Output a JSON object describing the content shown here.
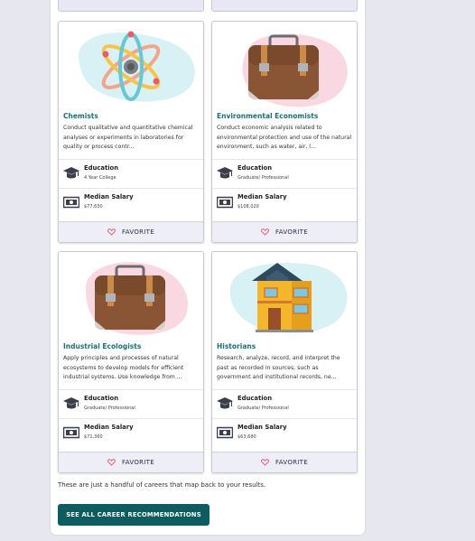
{
  "cards": [
    {
      "title": "Chemists",
      "description": "Conduct qualitative and quantitative chemical analyses or experiments in laboratories for quality or process contr...",
      "education_label": "Education",
      "education_value": "4 Year College",
      "salary_label": "Median Salary",
      "salary_value": "$77,630",
      "favorite_label": "FAVORITE",
      "image_icon": "atom-icon"
    },
    {
      "title": "Environmental Economists",
      "description": "Conduct economic analysis related to environmental protection and use of the natural environment, such as water, air, l...",
      "education_label": "Education",
      "education_value": "Graduate/ Professional",
      "salary_label": "Median Salary",
      "salary_value": "$108,020",
      "favorite_label": "FAVORITE",
      "image_icon": "briefcase-icon"
    },
    {
      "title": "Industrial Ecologists",
      "description": "Apply principles and processes of natural ecosystems to develop models for efficient industrial systems. Use knowledge from ...",
      "education_label": "Education",
      "education_value": "Graduate/ Professional",
      "salary_label": "Median Salary",
      "salary_value": "$71,360",
      "favorite_label": "FAVORITE",
      "image_icon": "briefcase-icon"
    },
    {
      "title": "Historians",
      "description": "Research, analyze, record, and interpret the past as recorded in sources, such as government and institutional records, ne...",
      "education_label": "Education",
      "education_value": "Graduate/ Professional",
      "salary_label": "Median Salary",
      "salary_value": "$63,680",
      "favorite_label": "FAVORITE",
      "image_icon": "house-icon"
    }
  ],
  "footnote": "These are just a handful of careers that map back to your results.",
  "cta_label": "SEE ALL CAREER RECOMMENDATIONS",
  "colors": {
    "title_teal": "#1d6e76",
    "cta_bg": "#0d5d60",
    "heart": "#e0566a",
    "page_bg": "#e6e7ef"
  }
}
